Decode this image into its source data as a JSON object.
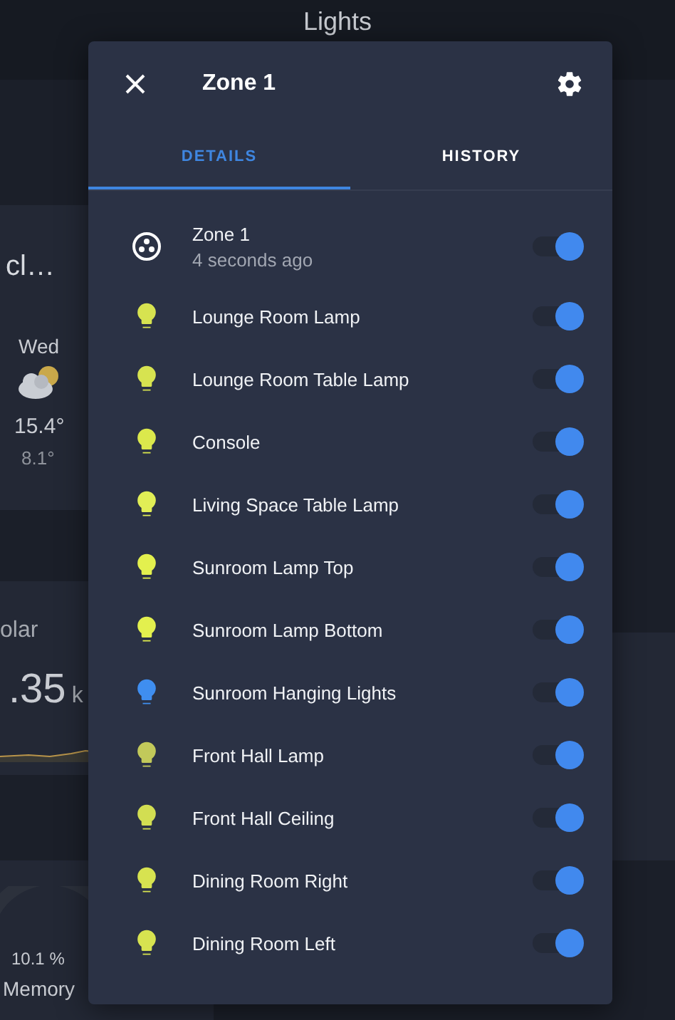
{
  "background": {
    "title": "Lights",
    "weather": {
      "condition": "cl…",
      "day": "Wed",
      "high": "15.4°",
      "low": "8.1°"
    },
    "energy": {
      "label": "olar",
      "value": ".35",
      "unit": "k"
    },
    "memory": {
      "value": "10.1 %",
      "label": "Memory"
    }
  },
  "dialog": {
    "title": "Zone 1",
    "tabs": [
      {
        "label": "DETAILS",
        "selected": true
      },
      {
        "label": "HISTORY",
        "selected": false
      }
    ],
    "entities": [
      {
        "kind": "group",
        "name": "Zone 1",
        "secondary": "4 seconds ago",
        "on": true
      },
      {
        "kind": "light",
        "name": "Lounge Room Lamp",
        "color": "#d7e350",
        "on": true
      },
      {
        "kind": "light",
        "name": "Lounge Room Table Lamp",
        "color": "#d7e350",
        "on": true
      },
      {
        "kind": "light",
        "name": "Console",
        "color": "#dbe84c",
        "on": true
      },
      {
        "kind": "light",
        "name": "Living Space Table Lamp",
        "color": "#e1ee56",
        "on": true
      },
      {
        "kind": "light",
        "name": "Sunroom Lamp Top",
        "color": "#e3f04e",
        "on": true
      },
      {
        "kind": "light",
        "name": "Sunroom Lamp Bottom",
        "color": "#e3f04e",
        "on": true
      },
      {
        "kind": "light",
        "name": "Sunroom Hanging Lights",
        "color": "#3f8ef0",
        "on": true
      },
      {
        "kind": "light",
        "name": "Front Hall Lamp",
        "color": "#c2c95a",
        "on": true
      },
      {
        "kind": "light",
        "name": "Front Hall Ceiling",
        "color": "#d2de52",
        "on": true
      },
      {
        "kind": "light",
        "name": "Dining Room Right",
        "color": "#d7e350",
        "on": true
      },
      {
        "kind": "light",
        "name": "Dining Room Left",
        "color": "#d7e350",
        "on": true
      }
    ]
  }
}
